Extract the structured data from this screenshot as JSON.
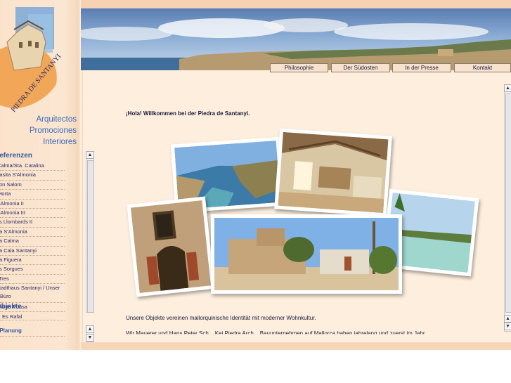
{
  "brand": {
    "lines": [
      "Arquitectos",
      "Promociones",
      "Interiores"
    ],
    "logo_text": "PIEDRA DE SANTANYI"
  },
  "nav": {
    "items": [
      "Philosophie",
      "Der Südosten",
      "In der Presse",
      "Kontakt"
    ]
  },
  "sidebar": {
    "referenzen_title": "Referenzen",
    "referenzen": [
      "Calma/Sta. Catalina",
      "Casita S'Almonia",
      "Son Salom",
      "Horta",
      "S'Almonia II",
      "S'Almonia III",
      "Es Llombards II",
      "Sa S'Almonia",
      "Sa Calma",
      "Sa Cala Santanyi",
      "Sa Figuera",
      "Es Sorgues",
      "Tres",
      "Stadthaus Santanyi / Unser Büro",
      "Santa Ponsa"
    ],
    "objekte_title": "Objekte",
    "objekte": [
      "Es Rafal"
    ],
    "planung_title": "In Planung"
  },
  "main": {
    "welcome": "¡Hola! Willkommen bei der Piedra de Santanyi.",
    "paragraph1": "Unsere Objekte vereinen mallorquinische Identität mit moderner Wohnkultur.",
    "paragraph2": "Wir Mauerer und Hans Peter Sch... Kei Piedra Arch... Bauunternehmen auf Mallorca haben jahrelang und zuerst im Jahr..."
  },
  "colors": {
    "accent": "#3a6ab8",
    "background": "#fdeedd",
    "band": "#f6d2b2"
  }
}
